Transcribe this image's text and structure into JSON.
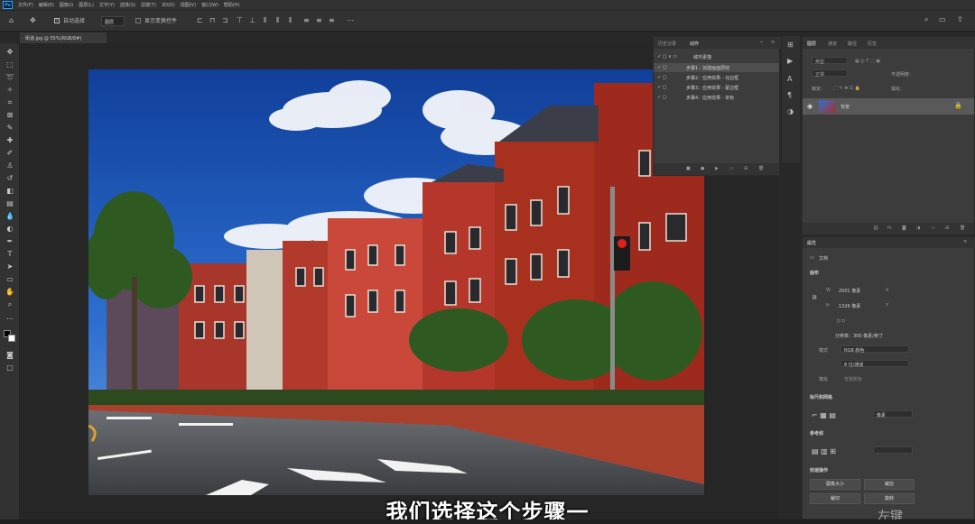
{
  "menu": {
    "app_icon": "Ps",
    "items": [
      "文件(F)",
      "编辑(E)",
      "图像(I)",
      "图层(L)",
      "文字(Y)",
      "选择(S)",
      "滤镜(T)",
      "3D(D)",
      "视图(V)",
      "窗口(W)",
      "帮助(H)"
    ]
  },
  "options": {
    "auto_select_label": "自动选择",
    "auto_select_value": "图层",
    "show_transform_label": "显示变换控件"
  },
  "document": {
    "tab_label": "街道.jpg @ 55%(RGB/8#)"
  },
  "actions_panel": {
    "tabs": [
      "历史记录",
      "动作"
    ],
    "group_name": "城市素描",
    "steps": [
      "步骤1：创建画面层结",
      "步骤2：应用效果 - 勾边框",
      "步骤3：应用效果 - 蒙边框",
      "步骤4：应用效果 - 单色"
    ]
  },
  "layers_panel": {
    "tabs": [
      "图层",
      "通道",
      "路径",
      "历史"
    ],
    "kind_label": "类型",
    "mode_label": "正常",
    "opacity_label": "不透明度：",
    "lock_label": "锁定：",
    "fill_label": "填充：",
    "layer_name": "背景"
  },
  "properties_panel": {
    "title": "属性",
    "doc_label": "文档",
    "canvas_label": "画布",
    "width_label": "W",
    "width_value": "2001 像素",
    "height_label": "H",
    "height_value": "1326 像素",
    "x_label": "X",
    "y_label": "Y",
    "resolution_text": "分辨率：300 像素/英寸",
    "mode_label": "模式",
    "mode_value": "RGB 颜色",
    "depth_value": "8 位/通道",
    "fill_label": "填充",
    "bg_color_label": "背景颜色",
    "rulers_label": "标尺和网格",
    "rulers_unit": "像素",
    "guides_label": "参考线",
    "quick_actions_label": "快速操作",
    "btn_image_size": "图像大小",
    "btn_crop": "裁剪",
    "btn_trim": "裁切",
    "btn_rotate": "旋转"
  },
  "subtitle": "我们选择这个步骤一",
  "watermark": "左键"
}
